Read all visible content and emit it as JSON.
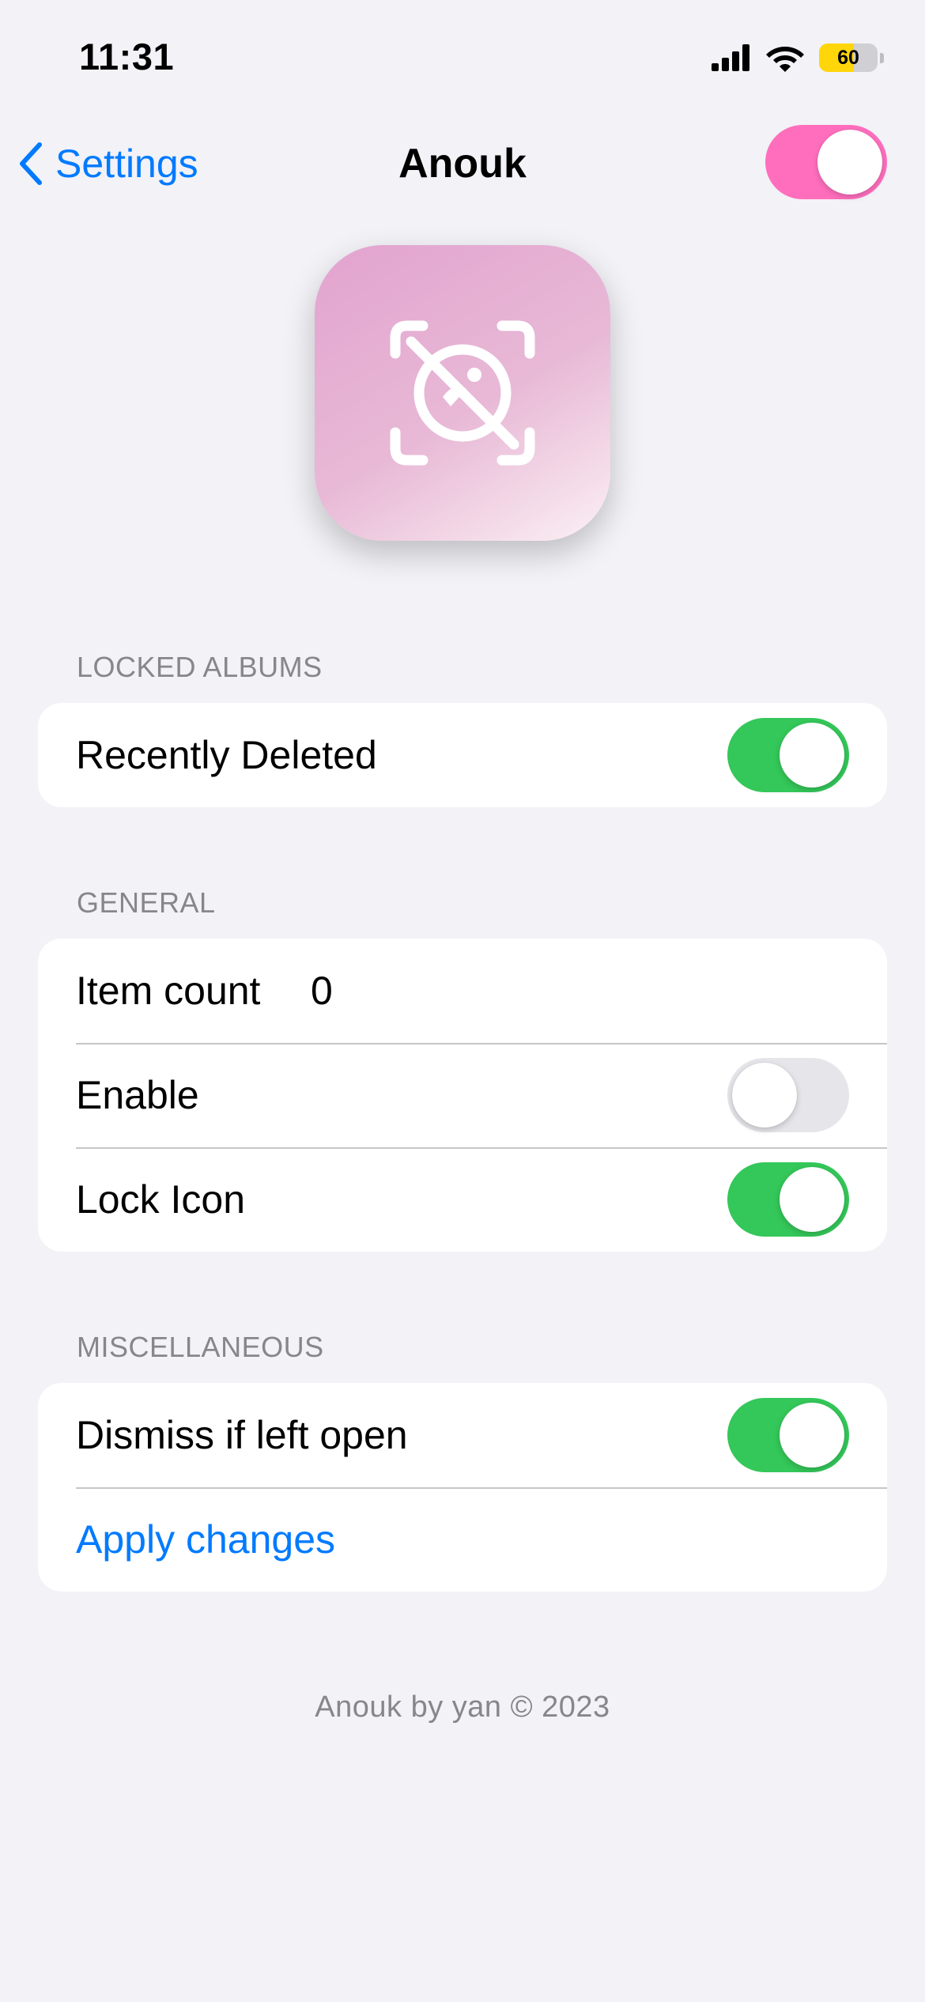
{
  "status_bar": {
    "time": "11:31",
    "battery_level": "60",
    "battery_fraction": 0.6,
    "icons": [
      "signal-icon",
      "wifi-icon",
      "battery-icon"
    ]
  },
  "nav": {
    "back_label": "Settings",
    "title": "Anouk",
    "master_toggle_on": true,
    "accent_color": "#ff6ebd"
  },
  "app_icon": {
    "icon_name": "eye-slash-scan-icon"
  },
  "sections": {
    "locked_albums": {
      "header": "LOCKED ALBUMS",
      "rows": [
        {
          "label": "Recently Deleted",
          "toggle_on": true
        }
      ]
    },
    "general": {
      "header": "GENERAL",
      "rows": [
        {
          "label": "Item count",
          "value": "0"
        },
        {
          "label": "Enable",
          "toggle_on": false
        },
        {
          "label": "Lock Icon",
          "toggle_on": true
        }
      ]
    },
    "miscellaneous": {
      "header": "MISCELLANEOUS",
      "rows": [
        {
          "label": "Dismiss if left open",
          "toggle_on": true
        },
        {
          "label": "Apply changes"
        }
      ]
    }
  },
  "footer": "Anouk by yan © 2023",
  "colors": {
    "link": "#007aff",
    "toggle_on": "#34c759",
    "toggle_off": "#e5e5ea",
    "background": "#f2f2f7"
  }
}
